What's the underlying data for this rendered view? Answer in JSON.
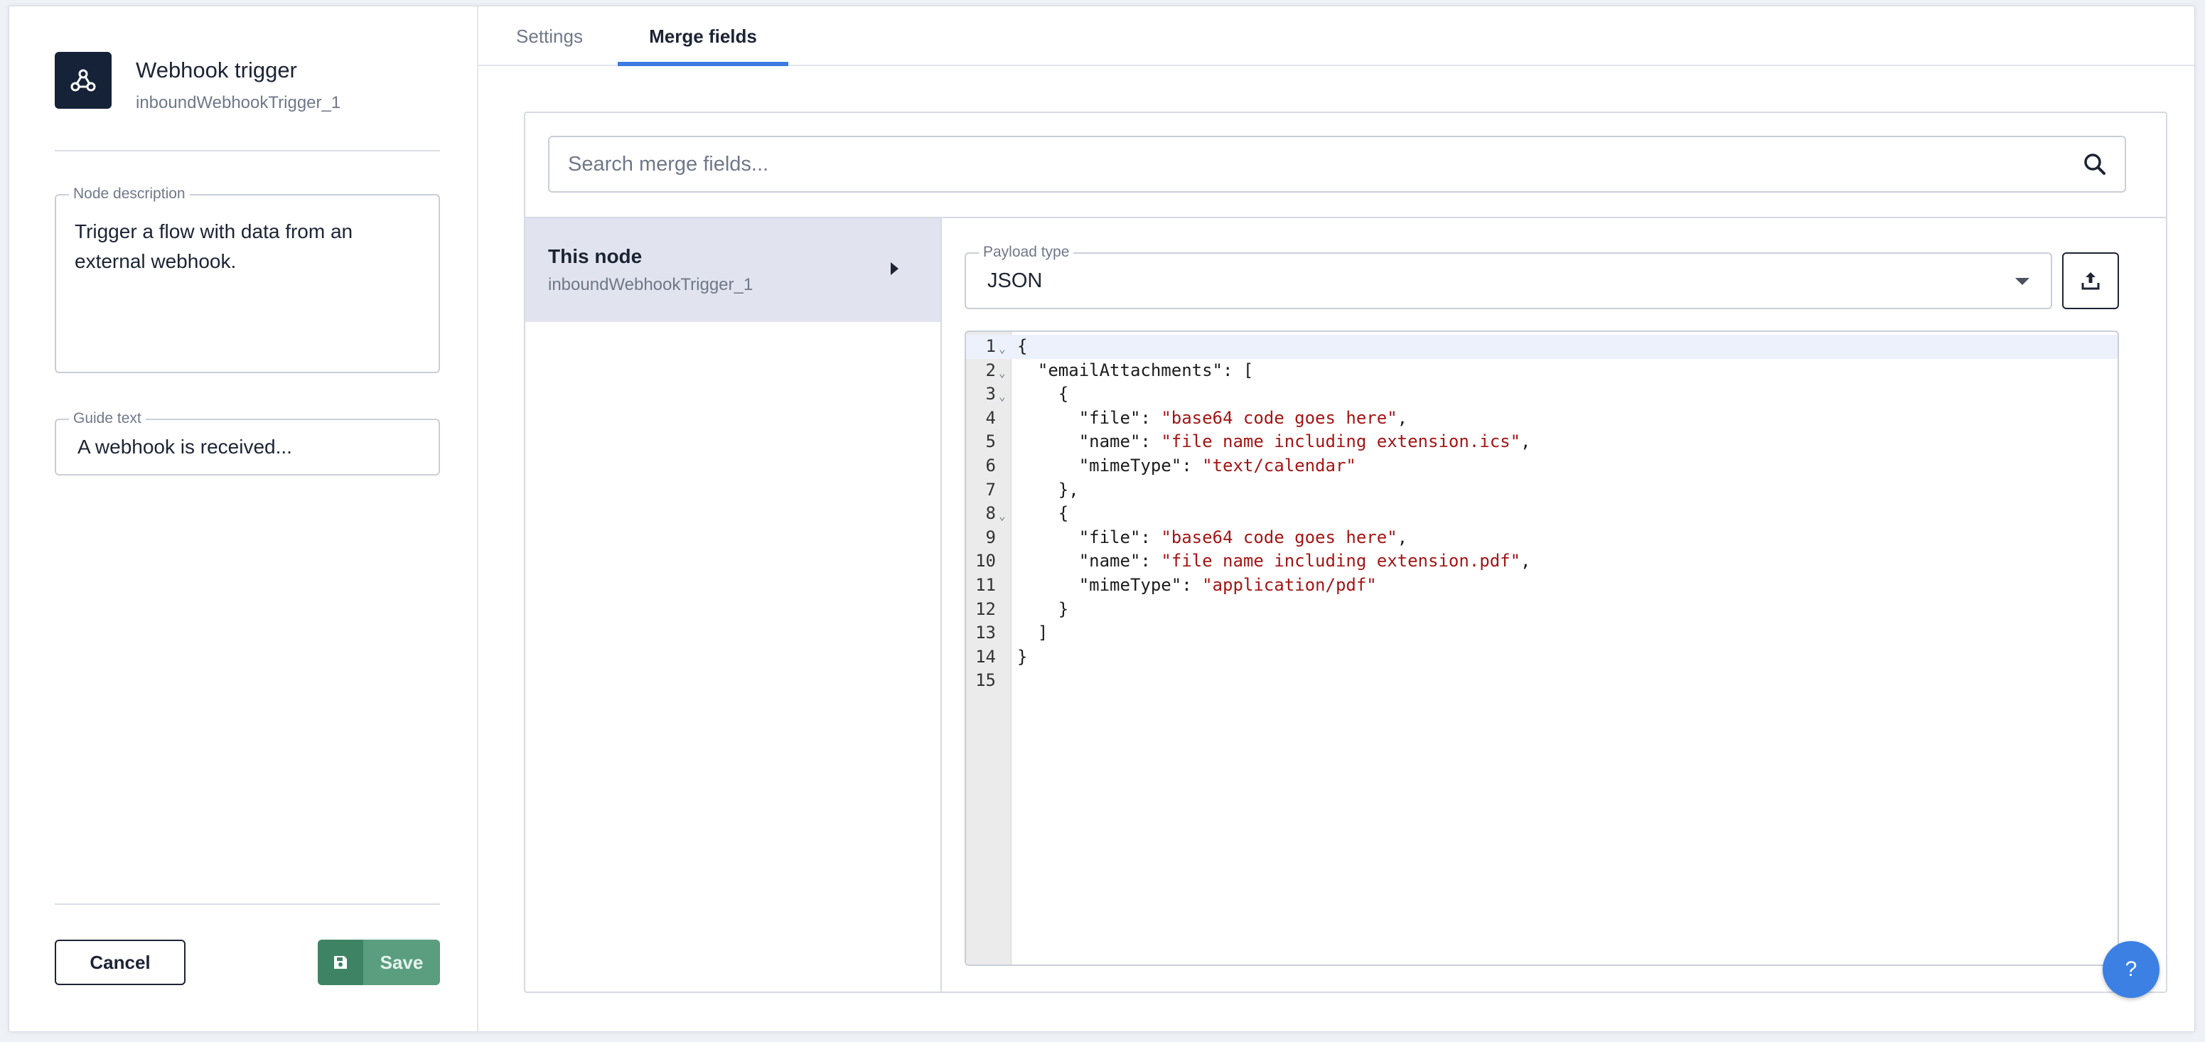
{
  "node": {
    "title": "Webhook trigger",
    "id": "inboundWebhookTrigger_1",
    "icon": "webhook-icon"
  },
  "description": {
    "label": "Node description",
    "value": "Trigger a flow with data from an external webhook."
  },
  "guide": {
    "label": "Guide text",
    "value": "A webhook is received..."
  },
  "footer": {
    "cancel_label": "Cancel",
    "save_label": "Save"
  },
  "tabs": [
    {
      "label": "Settings",
      "active": false
    },
    {
      "label": "Merge fields",
      "active": true
    }
  ],
  "search": {
    "placeholder": "Search merge fields...",
    "value": ""
  },
  "tree": {
    "items": [
      {
        "title": "This node",
        "subtitle": "inboundWebhookTrigger_1"
      }
    ]
  },
  "payload": {
    "label": "Payload type",
    "value": "JSON"
  },
  "editor": {
    "lines": [
      {
        "n": "1",
        "fold": true,
        "active": true,
        "tokens": [
          [
            "p",
            "{"
          ]
        ]
      },
      {
        "n": "2",
        "fold": true,
        "active": false,
        "tokens": [
          [
            "p",
            "  "
          ],
          [
            "k",
            "\"emailAttachments\""
          ],
          [
            "p",
            ": ["
          ]
        ]
      },
      {
        "n": "3",
        "fold": true,
        "active": false,
        "tokens": [
          [
            "p",
            "    {"
          ]
        ]
      },
      {
        "n": "4",
        "fold": false,
        "active": false,
        "tokens": [
          [
            "p",
            "      "
          ],
          [
            "k",
            "\"file\""
          ],
          [
            "p",
            ": "
          ],
          [
            "s",
            "\"base64 code goes here\""
          ],
          [
            "p",
            ","
          ]
        ]
      },
      {
        "n": "5",
        "fold": false,
        "active": false,
        "tokens": [
          [
            "p",
            "      "
          ],
          [
            "k",
            "\"name\""
          ],
          [
            "p",
            ": "
          ],
          [
            "s",
            "\"file name including extension.ics\""
          ],
          [
            "p",
            ","
          ]
        ]
      },
      {
        "n": "6",
        "fold": false,
        "active": false,
        "tokens": [
          [
            "p",
            "      "
          ],
          [
            "k",
            "\"mimeType\""
          ],
          [
            "p",
            ": "
          ],
          [
            "s",
            "\"text/calendar\""
          ]
        ]
      },
      {
        "n": "7",
        "fold": false,
        "active": false,
        "tokens": [
          [
            "p",
            "    },"
          ]
        ]
      },
      {
        "n": "8",
        "fold": true,
        "active": false,
        "tokens": [
          [
            "p",
            "    {"
          ]
        ]
      },
      {
        "n": "9",
        "fold": false,
        "active": false,
        "tokens": [
          [
            "p",
            "      "
          ],
          [
            "k",
            "\"file\""
          ],
          [
            "p",
            ": "
          ],
          [
            "s",
            "\"base64 code goes here\""
          ],
          [
            "p",
            ","
          ]
        ]
      },
      {
        "n": "10",
        "fold": false,
        "active": false,
        "tokens": [
          [
            "p",
            "      "
          ],
          [
            "k",
            "\"name\""
          ],
          [
            "p",
            ": "
          ],
          [
            "s",
            "\"file name including extension.pdf\""
          ],
          [
            "p",
            ","
          ]
        ]
      },
      {
        "n": "11",
        "fold": false,
        "active": false,
        "tokens": [
          [
            "p",
            "      "
          ],
          [
            "k",
            "\"mimeType\""
          ],
          [
            "p",
            ": "
          ],
          [
            "s",
            "\"application/pdf\""
          ]
        ]
      },
      {
        "n": "12",
        "fold": false,
        "active": false,
        "tokens": [
          [
            "p",
            "    }"
          ]
        ]
      },
      {
        "n": "13",
        "fold": false,
        "active": false,
        "tokens": [
          [
            "p",
            "  ]"
          ]
        ]
      },
      {
        "n": "14",
        "fold": false,
        "active": false,
        "tokens": [
          [
            "p",
            "}"
          ]
        ]
      },
      {
        "n": "15",
        "fold": false,
        "active": false,
        "tokens": [
          [
            "p",
            ""
          ]
        ]
      }
    ]
  },
  "help": {
    "label": "?"
  },
  "colors": {
    "accent": "#3b7be0",
    "save_green": "#5a9e7f",
    "node_icon_bg": "#152238",
    "string_red": "#a31515"
  }
}
